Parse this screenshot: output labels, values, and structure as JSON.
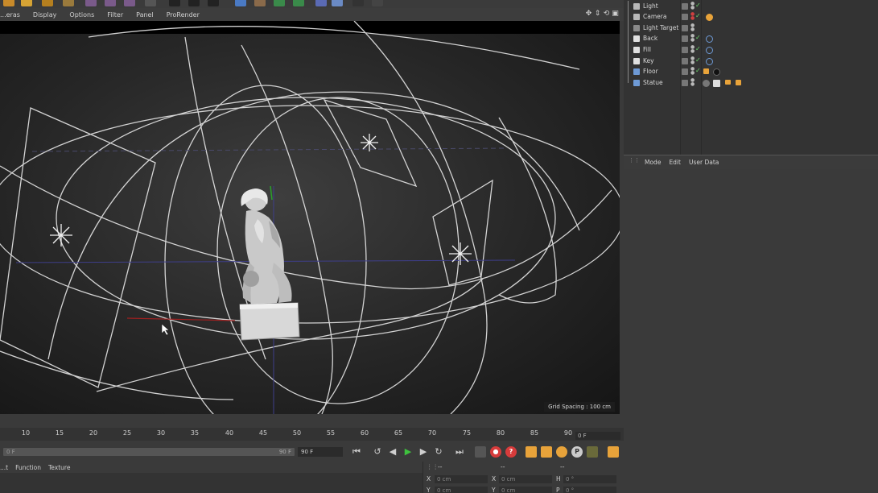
{
  "viewport_menu": [
    "...eras",
    "Display",
    "Options",
    "Filter",
    "Panel",
    "ProRender"
  ],
  "viewport": {
    "grid_label": "Grid Spacing : 100 cm"
  },
  "objects": [
    {
      "label": "Light",
      "icon": "light-icon",
      "color": "#b8b8b8"
    },
    {
      "label": "Camera",
      "icon": "camera-icon",
      "color": "#b8b8b8"
    },
    {
      "label": "Light Target",
      "icon": "null-icon",
      "color": "#b8b8b8"
    },
    {
      "label": "Back",
      "icon": "light-icon",
      "color": "#e0e0e0"
    },
    {
      "label": "Fill",
      "icon": "light-icon",
      "color": "#e0e0e0"
    },
    {
      "label": "Key",
      "icon": "light-icon",
      "color": "#e0e0e0"
    },
    {
      "label": "Floor",
      "icon": "floor-icon",
      "color": "#6e9ad6"
    },
    {
      "label": "Statue",
      "icon": "mesh-icon",
      "color": "#6e9ad6"
    }
  ],
  "attributes": {
    "menu": [
      "Mode",
      "Edit",
      "User Data"
    ]
  },
  "timeline": {
    "ticks": [
      "10",
      "15",
      "20",
      "25",
      "30",
      "35",
      "40",
      "45",
      "50",
      "55",
      "60",
      "65",
      "70",
      "75",
      "80",
      "85",
      "90"
    ],
    "current_frame": "0 F",
    "range_start": "0 F",
    "range_end": "90 F",
    "end_frame": "90 F"
  },
  "bottom_menu": [
    "...t",
    "Function",
    "Texture"
  ],
  "coordinates": {
    "header": [
      "--",
      "--",
      "--"
    ],
    "rows": [
      {
        "a_label": "X",
        "a_value": "0 cm",
        "b_label": "X",
        "b_value": "0 cm",
        "c_label": "H",
        "c_value": "0 °"
      },
      {
        "a_label": "Y",
        "a_value": "0 cm",
        "b_label": "Y",
        "b_value": "0 cm",
        "c_label": "P",
        "c_value": "0 °"
      }
    ]
  },
  "colors": {
    "accent_blue": "#6e9ad6",
    "check_green": "#6bd36b",
    "record_red": "#d63b3b",
    "key_orange": "#e8a33a"
  }
}
